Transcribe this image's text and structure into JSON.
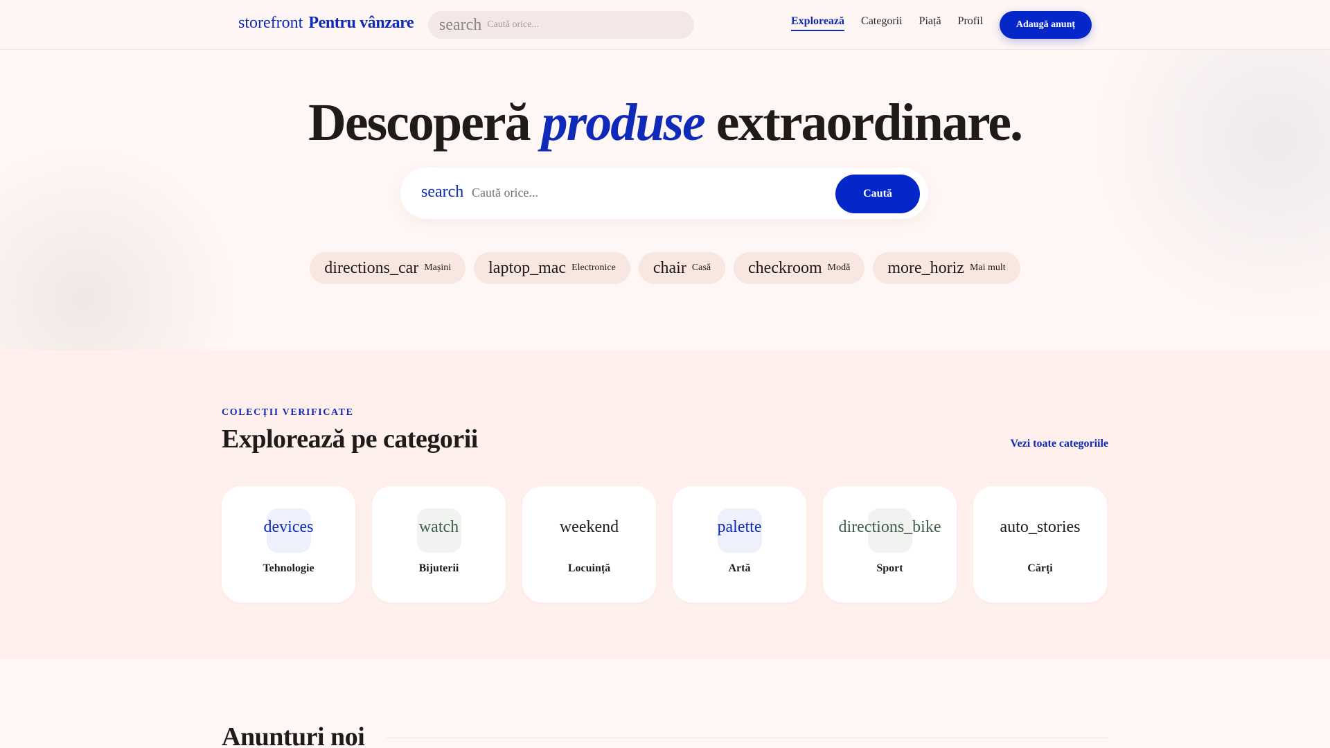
{
  "nav": {
    "brand_icon": "storefront",
    "brand_name": "Pentru vânzare",
    "search_icon": "search",
    "search_placeholder": "Caută orice...",
    "links": [
      "Explorează",
      "Categorii",
      "Piață",
      "Profil"
    ],
    "active_link": "Explorează",
    "add_button": "Adaugă anunț"
  },
  "hero": {
    "title_before": "Descoperă ",
    "title_accent": "produse",
    "title_after": " extraordinare.",
    "search_icon": "search",
    "search_placeholder": "Caută orice...",
    "search_button": "Caută",
    "chips": [
      {
        "icon": "directions_car",
        "label": "Mașini"
      },
      {
        "icon": "laptop_mac",
        "label": "Electronice"
      },
      {
        "icon": "chair",
        "label": "Casă"
      },
      {
        "icon": "checkroom",
        "label": "Modă"
      },
      {
        "icon": "more_horiz",
        "label": "Mai mult"
      }
    ]
  },
  "categories": {
    "eyebrow": "COLECȚII VERIFICATE",
    "title": "Explorează pe categorii",
    "see_all": "Vezi toate categoriile",
    "items": [
      {
        "icon": "devices",
        "label": "Tehnologie",
        "icon_color": "#0f2ab8",
        "tile_color": "#eef0fb"
      },
      {
        "icon": "watch",
        "label": "Bijuterii",
        "icon_color": "#3f5e47",
        "tile_color": "#f1f3f1"
      },
      {
        "icon": "weekend",
        "label": "Locuință",
        "icon_color": "#1e1b18",
        "tile_color": "#ffffff"
      },
      {
        "icon": "palette",
        "label": "Artă",
        "icon_color": "#0f2ab8",
        "tile_color": "#eef0fb"
      },
      {
        "icon": "directions_bike",
        "label": "Sport",
        "icon_color": "#3f5e47",
        "tile_color": "#f1f3f1"
      },
      {
        "icon": "auto_stories",
        "label": "Cărți",
        "icon_color": "#1e1b18",
        "tile_color": "#ffffff"
      }
    ]
  },
  "latest": {
    "title": "Anunturi noi"
  },
  "colors": {
    "accent": "#0f2ab8",
    "button": "#0526c9",
    "background": "#fff7f5",
    "section_background": "#fff0ed",
    "chip_background": "#f8e6e1"
  }
}
